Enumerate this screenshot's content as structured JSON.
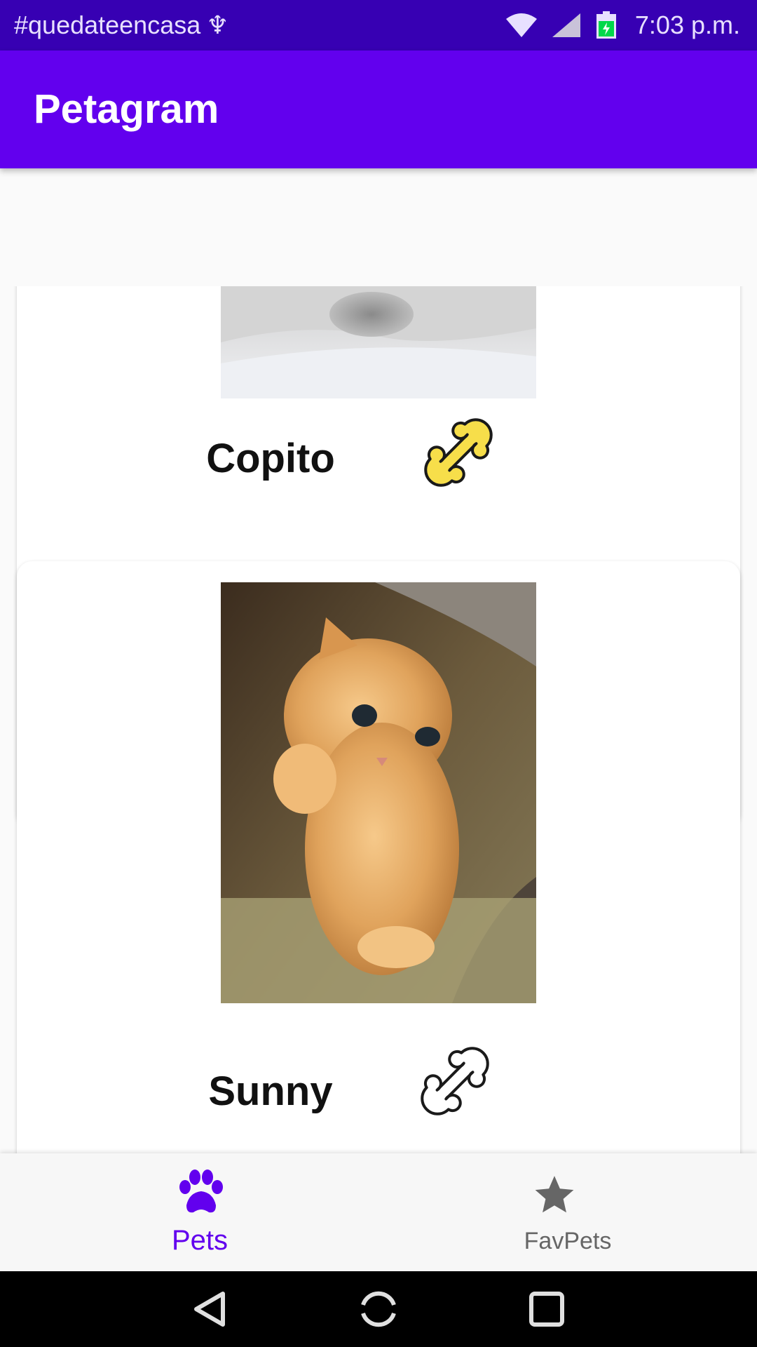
{
  "status_bar": {
    "left_text": "#quedateencasa",
    "usb_icon": "usb-icon",
    "time": "7:03 p.m.",
    "icons": [
      "wifi-icon",
      "signal-icon",
      "battery-charging-icon"
    ]
  },
  "app_bar": {
    "title": "Petagram"
  },
  "pets": [
    {
      "name": "Copito",
      "liked": true,
      "bone_icon": "bone-icon",
      "bone_color": "#f7de4a"
    },
    {
      "name": "Sunny",
      "liked": false,
      "bone_icon": "bone-icon",
      "bone_color": "#ffffff"
    }
  ],
  "bottom_nav": {
    "items": [
      {
        "label": "Pets",
        "icon": "paw-icon",
        "selected": true
      },
      {
        "label": "FavPets",
        "icon": "star-icon",
        "selected": false
      }
    ]
  },
  "colors": {
    "status_bar": "#3700b3",
    "app_bar": "#6200ee",
    "accent": "#6200ee",
    "inactive_nav": "#666666"
  },
  "system_nav": {
    "icons": [
      "back-icon",
      "home-icon",
      "recents-icon"
    ]
  }
}
